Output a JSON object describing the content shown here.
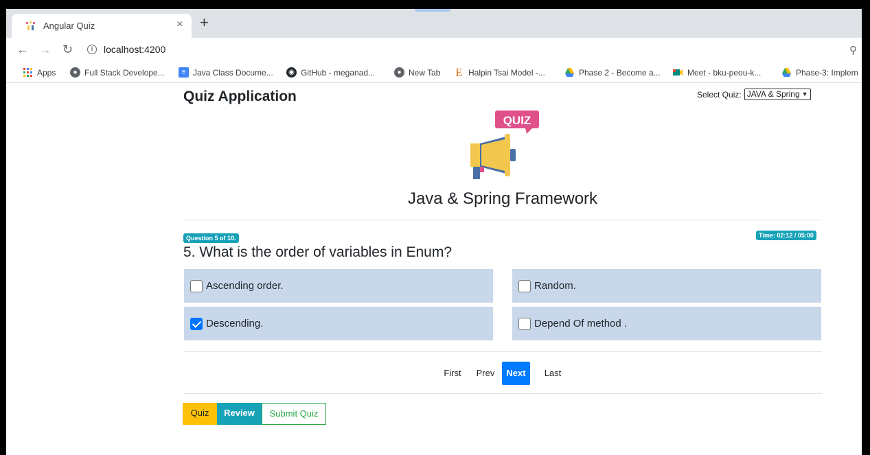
{
  "browser": {
    "tab_title": "Angular Quiz",
    "tab_close": "×",
    "new_tab": "+",
    "url": "localhost:4200",
    "bookmarks": [
      {
        "label": "Apps",
        "icon": "apps-grid-icon"
      },
      {
        "label": "Full Stack Develope...",
        "icon": "globe-icon"
      },
      {
        "label": "Java Class Docume...",
        "icon": "docs-icon"
      },
      {
        "label": "GitHub - meganad...",
        "icon": "github-icon"
      },
      {
        "label": "New Tab",
        "icon": "globe-icon"
      },
      {
        "label": "Halpin Tsai Model -...",
        "icon": "letter-e-icon"
      },
      {
        "label": "Phase 2 - Become a...",
        "icon": "drive-icon"
      },
      {
        "label": "Meet - bku-peou-k...",
        "icon": "meet-icon"
      },
      {
        "label": "Phase-3: Implem",
        "icon": "drive-icon"
      }
    ]
  },
  "header": {
    "title": "Quiz Application",
    "select_label": "Select Quiz:",
    "select_value": "JAVA & Spring"
  },
  "logo": {
    "text": "QUIZ",
    "colors": {
      "bubble": "#e0508a",
      "megaphone": "#f3c74d",
      "handle": "#4a6fa5"
    }
  },
  "quiz": {
    "name": "Java & Spring Framework",
    "progress_badge": "Question 5 of 10.",
    "time_badge": "Time: 02:12 / 05:00",
    "question": "5. What is the order of variables in Enum?",
    "options": [
      {
        "label": "Ascending order.",
        "checked": false
      },
      {
        "label": "Random.",
        "checked": false
      },
      {
        "label": "Descending.",
        "checked": true
      },
      {
        "label": "Depend Of method .",
        "checked": false
      }
    ]
  },
  "pager": {
    "first": "First",
    "prev": "Prev",
    "next": "Next",
    "last": "Last"
  },
  "actions": {
    "quiz": "Quiz",
    "review": "Review",
    "submit": "Submit Quiz"
  },
  "colors": {
    "option_bg": "#c8d7ea",
    "badge": "#17a2b8",
    "primary": "#007bff",
    "warning": "#ffc107",
    "success": "#28a745"
  }
}
